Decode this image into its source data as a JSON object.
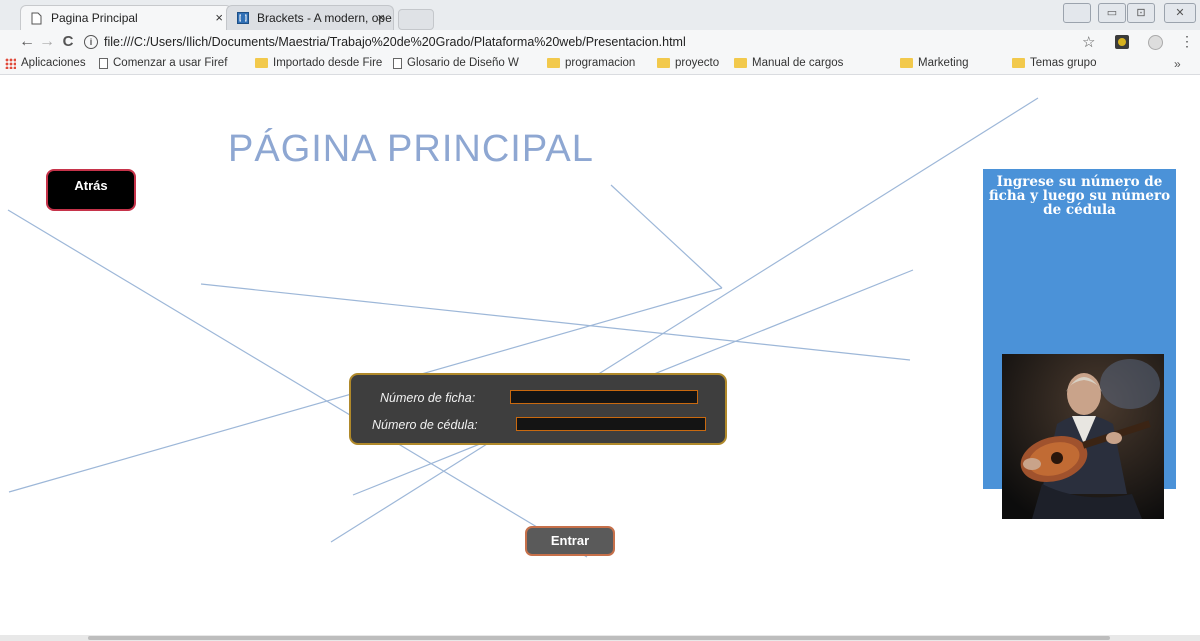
{
  "browser": {
    "tabs": [
      {
        "title": "Pagina Principal",
        "close": "×"
      },
      {
        "title": "Brackets - A modern, ope",
        "close": "×"
      }
    ],
    "window_controls": [
      "▭",
      "⊡",
      "✕"
    ],
    "back": "←",
    "forward": "→",
    "reload": "C",
    "url": "file:///C:/Users/Ilich/Documents/Maestria/Trabajo%20de%20Grado/Plataforma%20web/Presentacion.html",
    "bookmarks": [
      {
        "label": "Aplicaciones",
        "icon": "apps-icon"
      },
      {
        "label": "Comenzar a usar Firef",
        "icon": "page-icon"
      },
      {
        "label": "Importado desde Fire",
        "icon": "folder-icon"
      },
      {
        "label": "Glosario de Diseño W",
        "icon": "page-icon"
      },
      {
        "label": "programacion",
        "icon": "folder-icon"
      },
      {
        "label": "proyecto",
        "icon": "folder-icon"
      },
      {
        "label": "Manual de cargos",
        "icon": "folder-icon"
      },
      {
        "label": "Marketing",
        "icon": "folder-icon"
      },
      {
        "label": "Temas grupo",
        "icon": "folder-icon"
      }
    ],
    "more_bookmarks": "»"
  },
  "page": {
    "title": "PÁGINA PRINCIPAL",
    "back_button": "Atrás",
    "form": {
      "ficha_label": "Número de ficha:",
      "ficha_value": "",
      "cedula_label": "Número de cédula:",
      "cedula_value": ""
    },
    "submit_button": "Entrar",
    "side_panel_text": "Ingrese su número de ficha y luego su número de cédula"
  },
  "colors": {
    "title": "#8ea7d2",
    "side_panel": "#4b92d8",
    "form_panel": "#3e3e3e",
    "lines": "#9db7d8"
  }
}
